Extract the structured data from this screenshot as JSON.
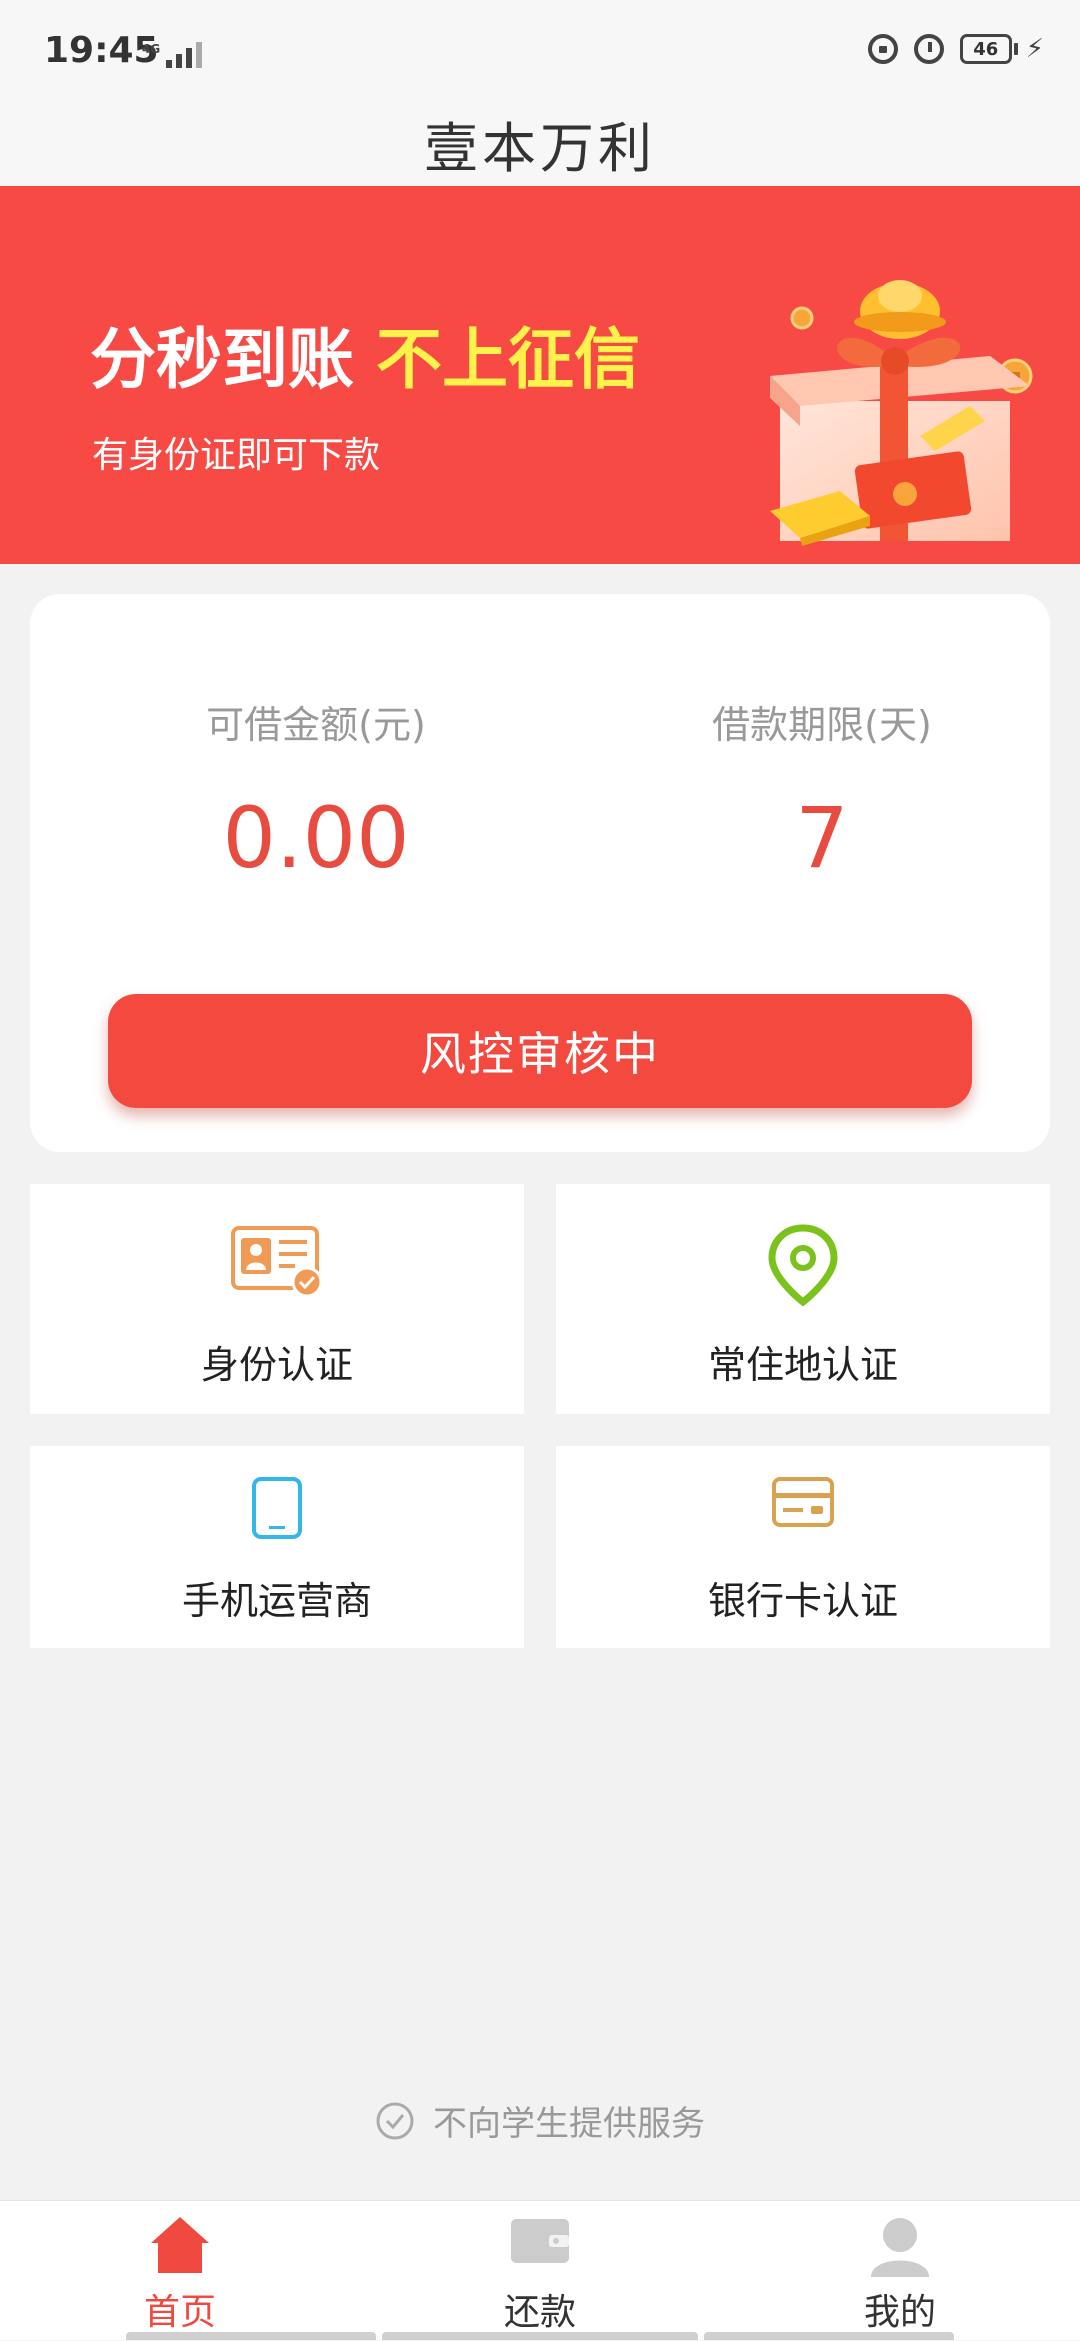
{
  "status_bar": {
    "time": "19:45",
    "network": "4G",
    "battery": "46"
  },
  "header": {
    "title": "壹本万利"
  },
  "banner": {
    "headline": "分秒到账",
    "highlight": "不上征信",
    "subtitle": "有身份证即可下款"
  },
  "loan": {
    "amount_label": "可借金额(元)",
    "amount_value": "0.00",
    "term_label": "借款期限(天)",
    "term_value": "7",
    "button_label": "风控审核中"
  },
  "verification": {
    "items": [
      {
        "label": "身份认证",
        "icon": "id-card-icon"
      },
      {
        "label": "常住地认证",
        "icon": "location-pin-icon"
      },
      {
        "label": "手机运营商",
        "icon": "phone-icon"
      },
      {
        "label": "银行卡认证",
        "icon": "bank-card-icon"
      }
    ]
  },
  "notice": {
    "text": "不向学生提供服务"
  },
  "nav": {
    "items": [
      {
        "label": "首页",
        "icon": "home-icon",
        "active": true
      },
      {
        "label": "还款",
        "icon": "wallet-icon",
        "active": false
      },
      {
        "label": "我的",
        "icon": "user-icon",
        "active": false
      }
    ]
  },
  "colors": {
    "brand_red": "#f84a45",
    "button_red": "#f4493f",
    "value_red": "#e84b40",
    "highlight_yellow": "#fff24a",
    "id_orange": "#f19a55",
    "pin_green": "#7bc21d",
    "phone_blue": "#33b6e8",
    "card_gold": "#d9a24f"
  }
}
